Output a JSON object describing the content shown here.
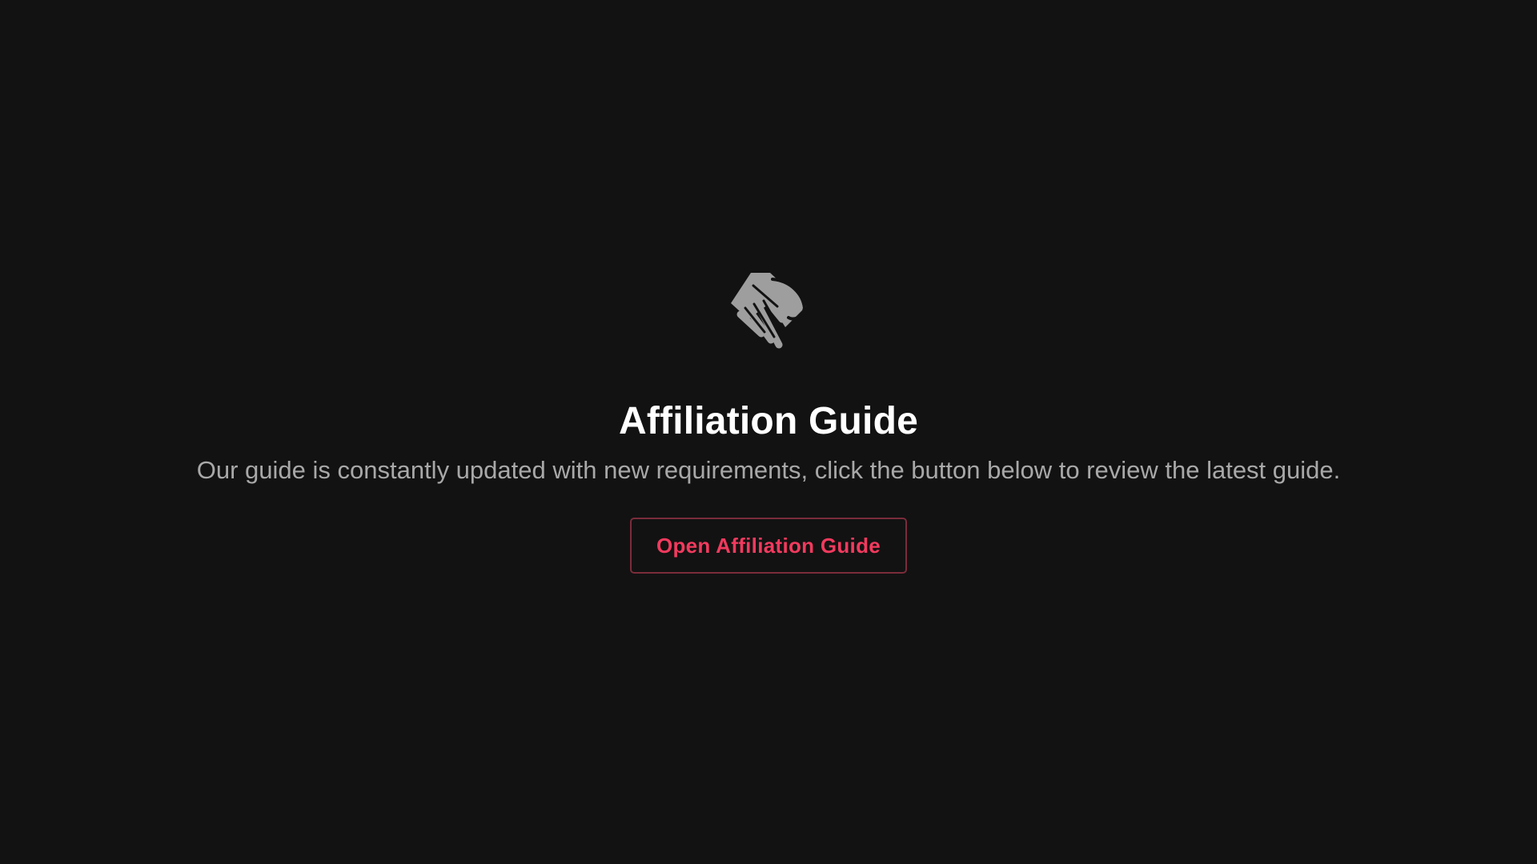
{
  "header": {
    "icon": "handshake-icon",
    "title": "Affiliation Guide",
    "description": "Our guide is constantly updated with new requirements, click the button below to review the latest guide."
  },
  "actions": {
    "open_guide_label": "Open Affiliation Guide"
  },
  "colors": {
    "background": "#121212",
    "title": "#ffffff",
    "description": "#a8a8a8",
    "icon": "#9e9e9e",
    "accent": "#f23a5e",
    "button_border": "#7a2c3a"
  }
}
